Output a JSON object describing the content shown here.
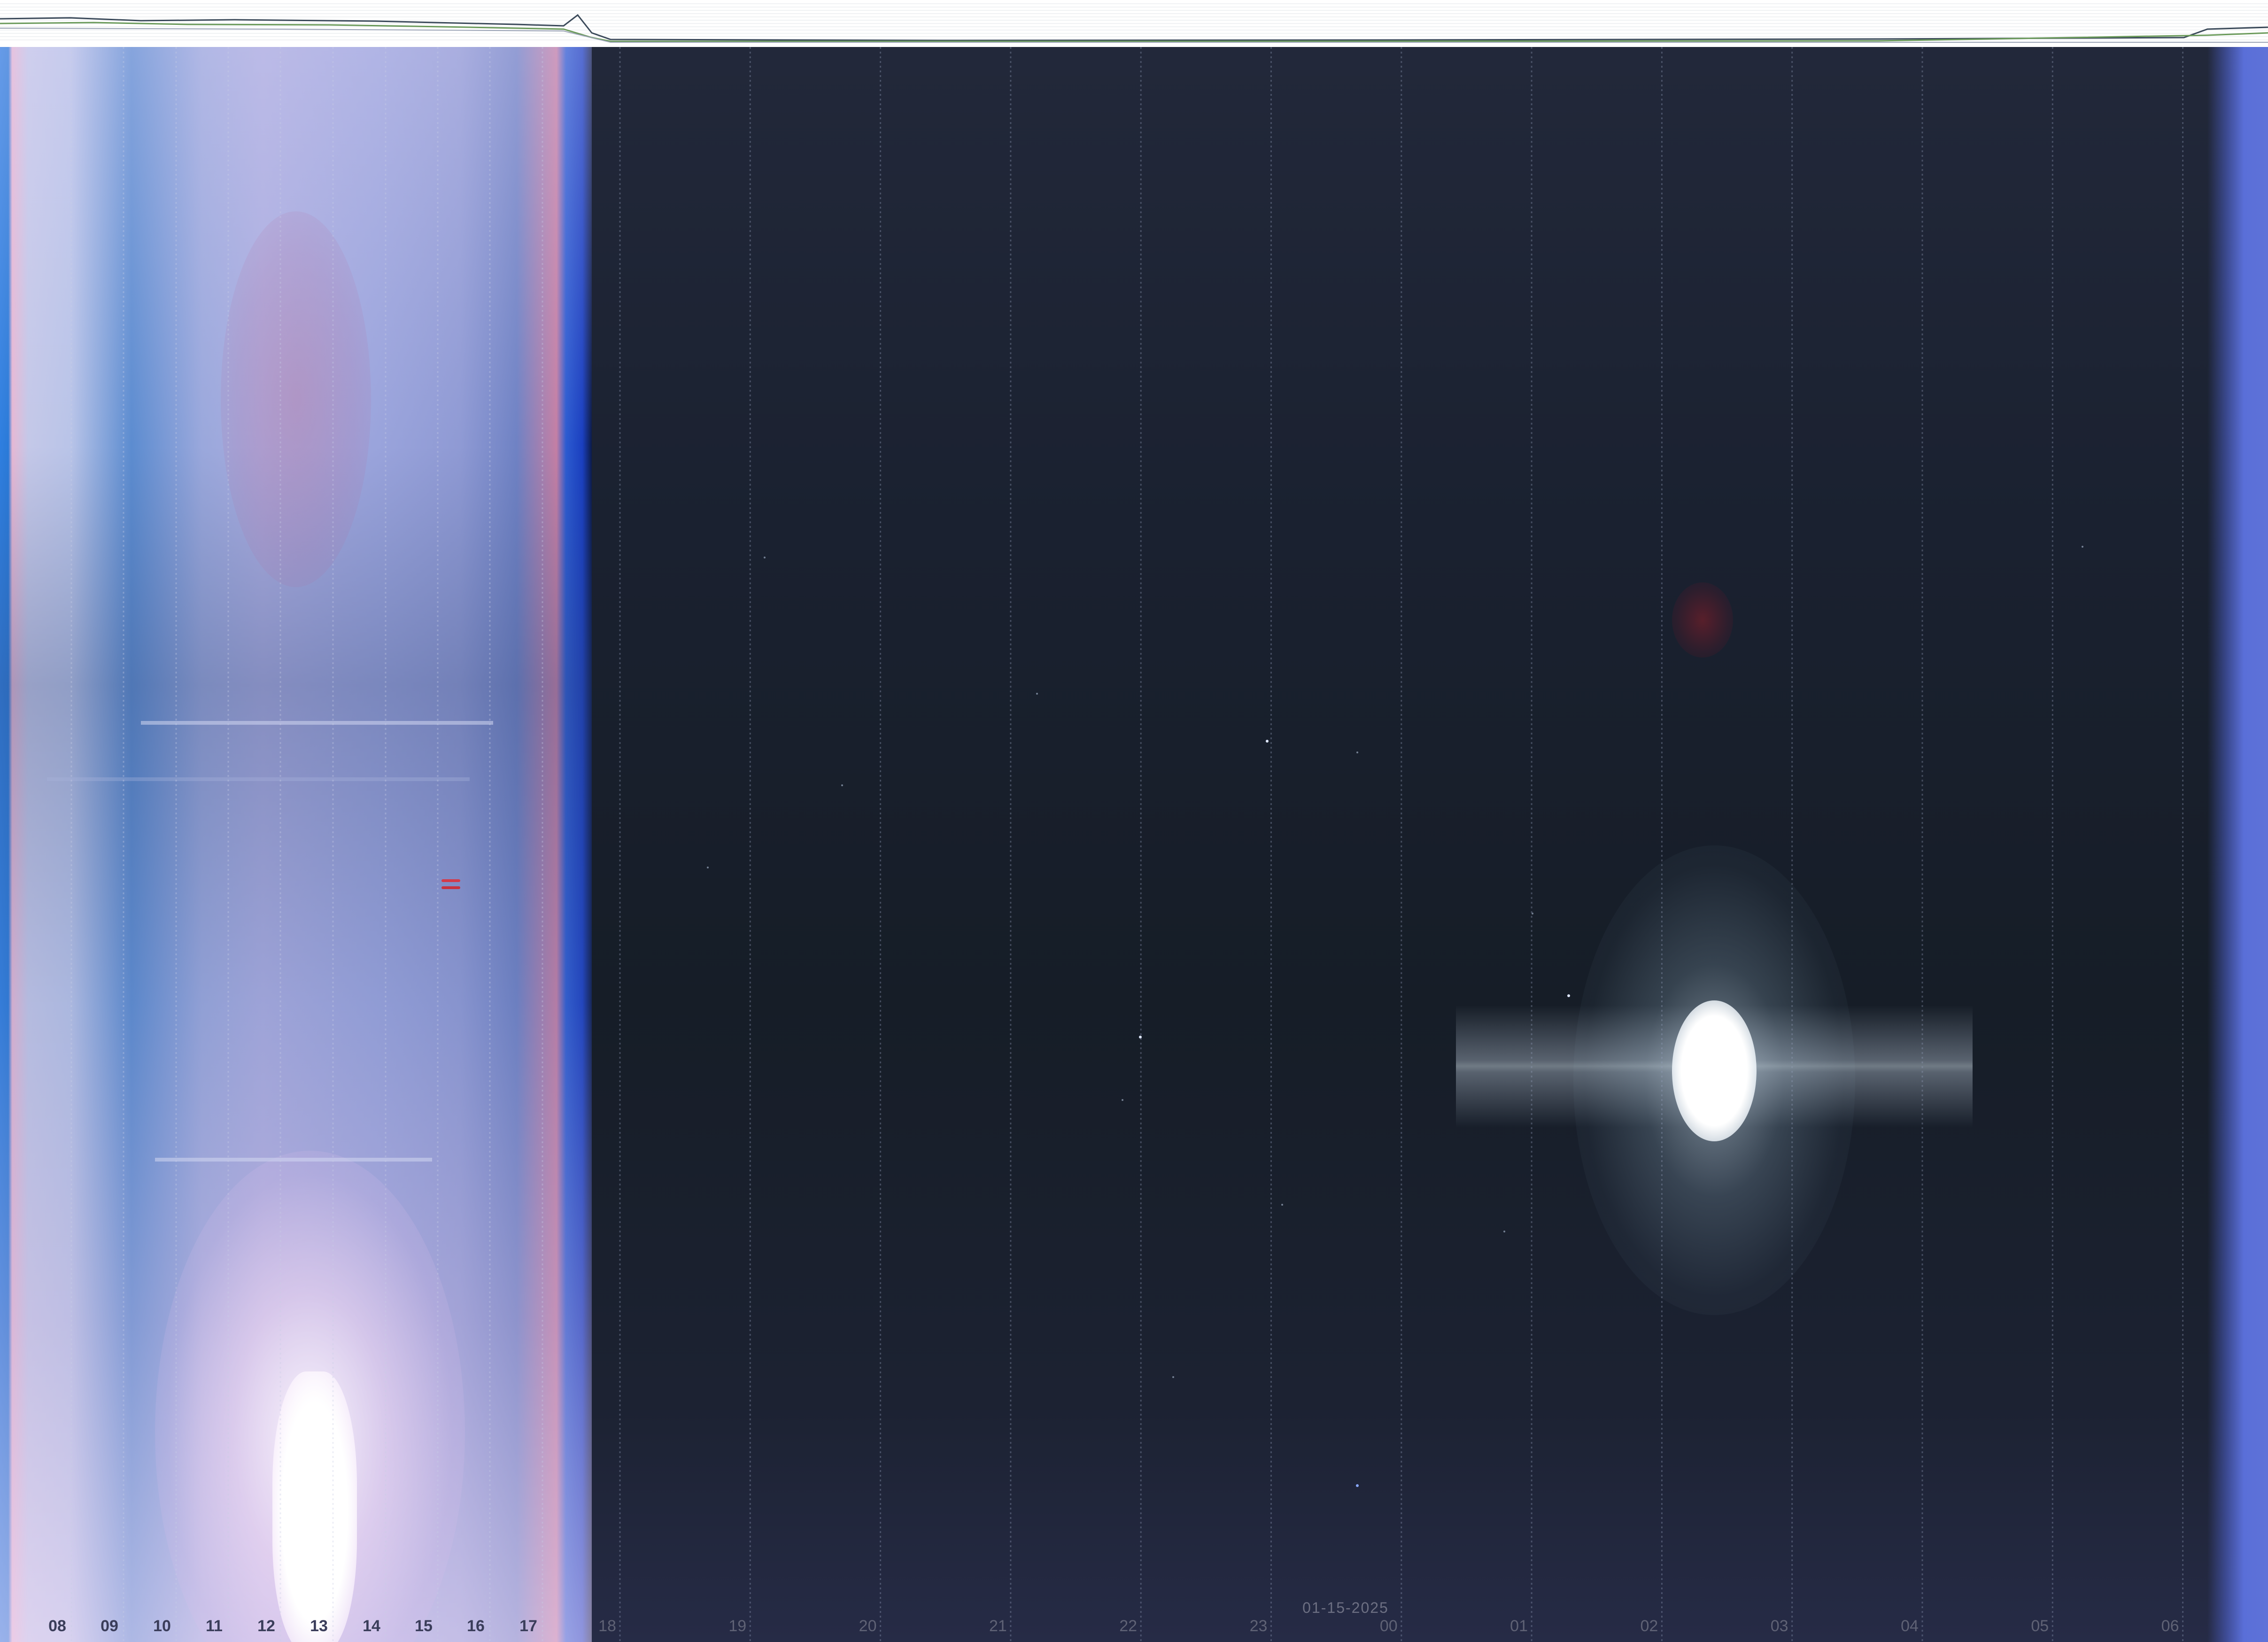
{
  "image": {
    "description_kind": "all-sky keogram with sensor graph strip",
    "date_label": "01-15-2025",
    "hour_labels": [
      "08",
      "09",
      "10",
      "11",
      "12",
      "13",
      "14",
      "15",
      "16",
      "17",
      "18",
      "19",
      "20",
      "21",
      "22",
      "23",
      "00",
      "01",
      "02",
      "03",
      "04",
      "05",
      "06"
    ],
    "day_hour_labels": [
      "08",
      "09",
      "10",
      "11",
      "12",
      "13",
      "14",
      "15",
      "16",
      "17"
    ],
    "colors": {
      "graph_background": "#ffffff",
      "night_sky": "#161d27",
      "day_sky": "#a9acdf",
      "graph_line_dark": "#3b4a5a",
      "graph_line_green": "#6a9a5a",
      "grid_line": "#9aa0b8"
    }
  }
}
